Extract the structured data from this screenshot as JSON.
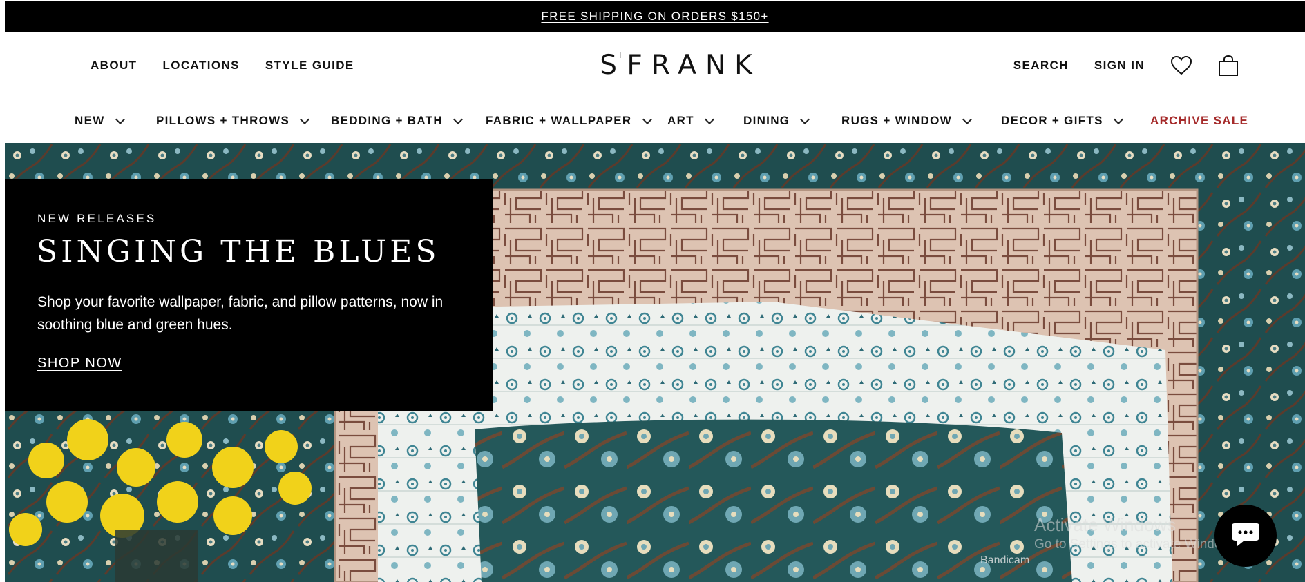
{
  "promo_bar": {
    "text": "FREE SHIPPING ON ORDERS $150+"
  },
  "header": {
    "left_links": [
      "ABOUT",
      "LOCATIONS",
      "STYLE GUIDE"
    ],
    "logo": {
      "main": "FRANK",
      "prefix": "S",
      "sup": "T"
    },
    "search_label": "SEARCH",
    "signin_label": "SIGN IN",
    "icons": [
      "heart-icon",
      "shopping-bag-icon"
    ]
  },
  "categories": [
    {
      "label": "NEW"
    },
    {
      "label": "PILLOWS + THROWS"
    },
    {
      "label": "BEDDING + BATH"
    },
    {
      "label": "FABRIC + WALLPAPER"
    },
    {
      "label": "ART"
    },
    {
      "label": "DINING"
    },
    {
      "label": "RUGS + WINDOW"
    },
    {
      "label": "DECOR + GIFTS"
    },
    {
      "label": "ARCHIVE SALE"
    }
  ],
  "hero": {
    "eyebrow": "NEW RELEASES",
    "headline": "SINGING THE BLUES",
    "description": "Shop your favorite wallpaper, fabric, and pillow patterns, now in soothing blue and green hues.",
    "cta": "SHOP NOW"
  },
  "overlay": {
    "watermark_line1": "Activate Windows",
    "watermark_line2": "Go to Settings to activate Windows.",
    "recorder": "Bandicam"
  },
  "colors": {
    "sale": "#a52a2a",
    "hero_bg": "#1f4d4f",
    "black": "#000000"
  }
}
